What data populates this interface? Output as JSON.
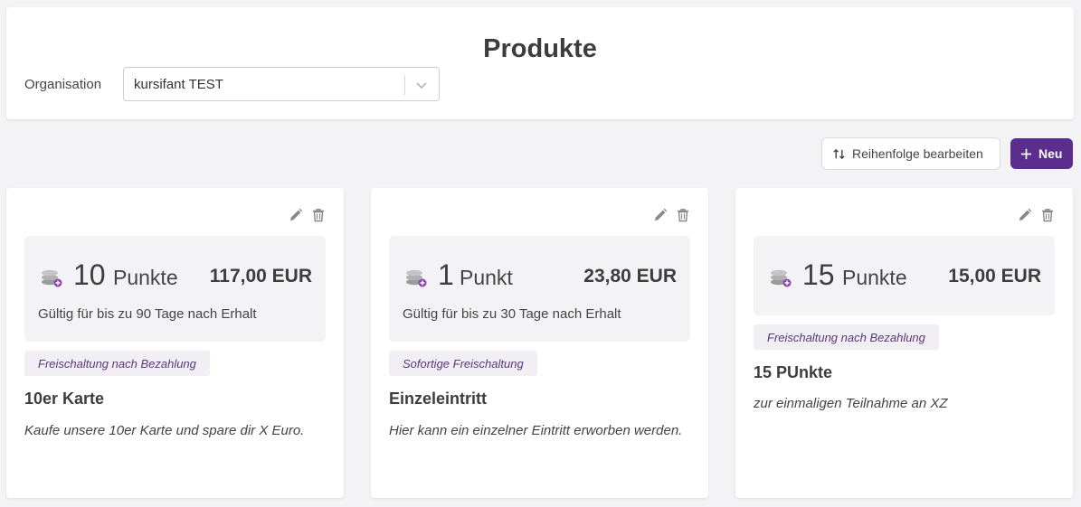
{
  "header": {
    "title": "Produkte",
    "organisation_label": "Organisation",
    "organisation_value": "kursifant TEST"
  },
  "toolbar": {
    "reorder_label": "Reihenfolge bearbeiten",
    "new_label": "Neu"
  },
  "colors": {
    "accent": "#5b2d8e",
    "background": "#f3f3f5",
    "badge_bg": "#f1eef4"
  },
  "products": [
    {
      "points": "10",
      "unit": "Punkte",
      "price": "117,00 EUR",
      "validity": "Gültig für bis zu 90 Tage nach Erhalt",
      "badge": "Freischaltung nach Bezahlung",
      "title": "10er Karte",
      "description": "Kaufe unsere 10er Karte und spare dir X Euro."
    },
    {
      "points": "1",
      "unit": "Punkt",
      "price": "23,80 EUR",
      "validity": "Gültig für bis zu 30 Tage nach Erhalt",
      "badge": "Sofortige Freischaltung",
      "title": "Einzeleintritt",
      "description": "Hier kann ein einzelner Eintritt erworben werden."
    },
    {
      "points": "15",
      "unit": "Punkte",
      "price": "15,00 EUR",
      "validity": "",
      "badge": "Freischaltung nach Bezahlung",
      "title": "15 PUnkte",
      "description": "zur einmaligen Teilnahme an XZ"
    }
  ],
  "icons": {
    "edit": "pencil-icon",
    "delete": "trash-icon",
    "coins": "coins-icon",
    "sort": "sort-arrows-icon",
    "plus": "plus-icon",
    "chevron": "chevron-down-icon"
  }
}
